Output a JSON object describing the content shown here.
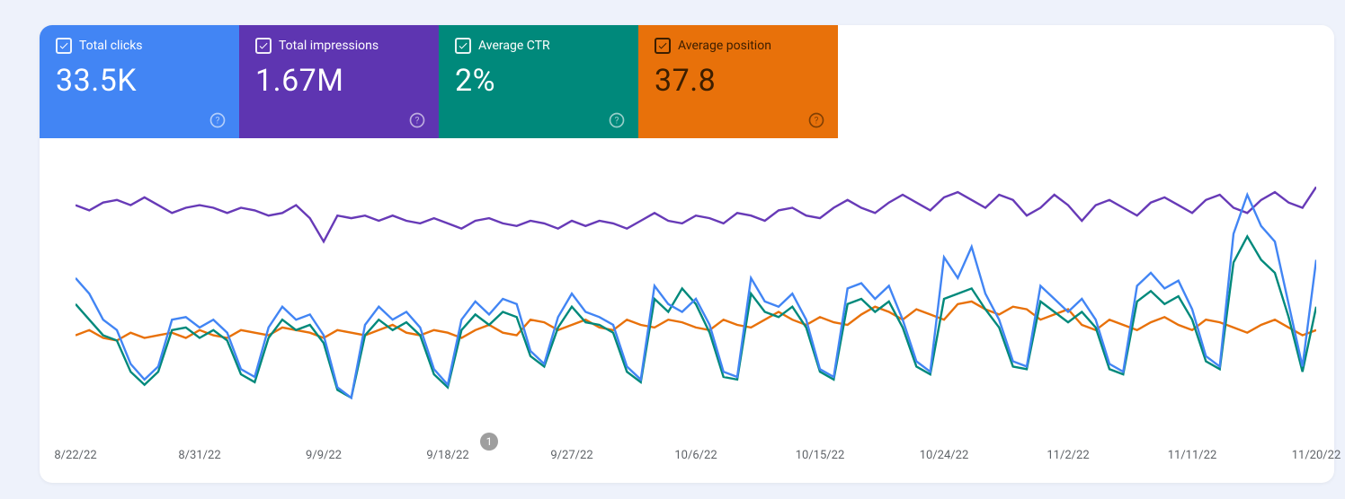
{
  "metrics": {
    "clicks": {
      "label": "Total clicks",
      "value": "33.5K"
    },
    "impressions": {
      "label": "Total impressions",
      "value": "1.67M"
    },
    "ctr": {
      "label": "Average CTR",
      "value": "2%"
    },
    "position": {
      "label": "Average position",
      "value": "37.8"
    }
  },
  "note_badge": "1",
  "x_ticks": [
    "8/22/22",
    "8/31/22",
    "9/9/22",
    "9/18/22",
    "9/27/22",
    "10/6/22",
    "10/15/22",
    "10/24/22",
    "11/2/22",
    "11/11/22",
    "11/20/22"
  ],
  "chart_data": {
    "type": "line",
    "title": "",
    "xlabel": "",
    "ylabel": "",
    "categories": [
      "8/22/22",
      "8/23/22",
      "8/24/22",
      "8/25/22",
      "8/26/22",
      "8/27/22",
      "8/28/22",
      "8/29/22",
      "8/30/22",
      "8/31/22",
      "9/1/22",
      "9/2/22",
      "9/3/22",
      "9/4/22",
      "9/5/22",
      "9/6/22",
      "9/7/22",
      "9/8/22",
      "9/9/22",
      "9/10/22",
      "9/11/22",
      "9/12/22",
      "9/13/22",
      "9/14/22",
      "9/15/22",
      "9/16/22",
      "9/17/22",
      "9/18/22",
      "9/19/22",
      "9/20/22",
      "9/21/22",
      "9/22/22",
      "9/23/22",
      "9/24/22",
      "9/25/22",
      "9/26/22",
      "9/27/22",
      "9/28/22",
      "9/29/22",
      "9/30/22",
      "10/1/22",
      "10/2/22",
      "10/3/22",
      "10/4/22",
      "10/5/22",
      "10/6/22",
      "10/7/22",
      "10/8/22",
      "10/9/22",
      "10/10/22",
      "10/11/22",
      "10/12/22",
      "10/13/22",
      "10/14/22",
      "10/15/22",
      "10/16/22",
      "10/17/22",
      "10/18/22",
      "10/19/22",
      "10/20/22",
      "10/21/22",
      "10/22/22",
      "10/23/22",
      "10/24/22",
      "10/25/22",
      "10/26/22",
      "10/27/22",
      "10/28/22",
      "10/29/22",
      "10/30/22",
      "10/31/22",
      "11/1/22",
      "11/2/22",
      "11/3/22",
      "11/4/22",
      "11/5/22",
      "11/6/22",
      "11/7/22",
      "11/8/22",
      "11/9/22",
      "11/10/22",
      "11/11/22",
      "11/12/22",
      "11/13/22",
      "11/14/22",
      "11/15/22",
      "11/16/22",
      "11/17/22",
      "11/18/22",
      "11/19/22",
      "11/20/22"
    ],
    "series": [
      {
        "name": "Impressions",
        "color": "#673ab7",
        "normalized": [
          0.86,
          0.84,
          0.87,
          0.88,
          0.86,
          0.89,
          0.86,
          0.83,
          0.85,
          0.86,
          0.85,
          0.83,
          0.85,
          0.84,
          0.82,
          0.83,
          0.86,
          0.81,
          0.72,
          0.82,
          0.81,
          0.82,
          0.8,
          0.82,
          0.8,
          0.79,
          0.81,
          0.79,
          0.77,
          0.8,
          0.81,
          0.79,
          0.78,
          0.8,
          0.79,
          0.77,
          0.8,
          0.78,
          0.8,
          0.79,
          0.77,
          0.8,
          0.83,
          0.8,
          0.79,
          0.82,
          0.81,
          0.79,
          0.83,
          0.82,
          0.8,
          0.84,
          0.85,
          0.82,
          0.81,
          0.85,
          0.88,
          0.85,
          0.83,
          0.87,
          0.9,
          0.87,
          0.84,
          0.89,
          0.91,
          0.88,
          0.85,
          0.9,
          0.88,
          0.82,
          0.85,
          0.9,
          0.86,
          0.8,
          0.86,
          0.88,
          0.85,
          0.82,
          0.87,
          0.89,
          0.86,
          0.83,
          0.88,
          0.9,
          0.85,
          0.83,
          0.88,
          0.91,
          0.87,
          0.85,
          0.93
        ]
      },
      {
        "name": "Clicks",
        "color": "#4285f4",
        "normalized": [
          0.58,
          0.52,
          0.42,
          0.38,
          0.25,
          0.19,
          0.24,
          0.42,
          0.43,
          0.39,
          0.42,
          0.37,
          0.23,
          0.2,
          0.39,
          0.47,
          0.42,
          0.44,
          0.36,
          0.16,
          0.12,
          0.4,
          0.47,
          0.42,
          0.45,
          0.39,
          0.23,
          0.17,
          0.42,
          0.49,
          0.44,
          0.5,
          0.48,
          0.3,
          0.25,
          0.43,
          0.52,
          0.45,
          0.43,
          0.4,
          0.24,
          0.19,
          0.55,
          0.48,
          0.45,
          0.5,
          0.4,
          0.22,
          0.2,
          0.58,
          0.49,
          0.47,
          0.52,
          0.42,
          0.23,
          0.2,
          0.54,
          0.56,
          0.5,
          0.55,
          0.42,
          0.26,
          0.22,
          0.66,
          0.58,
          0.7,
          0.52,
          0.42,
          0.26,
          0.24,
          0.55,
          0.5,
          0.45,
          0.5,
          0.42,
          0.25,
          0.22,
          0.55,
          0.6,
          0.54,
          0.57,
          0.46,
          0.28,
          0.24,
          0.75,
          0.9,
          0.78,
          0.72,
          0.48,
          0.24,
          0.65
        ]
      },
      {
        "name": "CTR",
        "color": "#00897b",
        "normalized": [
          0.48,
          0.42,
          0.36,
          0.34,
          0.22,
          0.17,
          0.22,
          0.38,
          0.39,
          0.35,
          0.38,
          0.34,
          0.21,
          0.18,
          0.35,
          0.42,
          0.38,
          0.4,
          0.33,
          0.15,
          0.12,
          0.36,
          0.42,
          0.38,
          0.41,
          0.36,
          0.21,
          0.16,
          0.38,
          0.44,
          0.4,
          0.45,
          0.43,
          0.28,
          0.24,
          0.39,
          0.47,
          0.41,
          0.4,
          0.37,
          0.22,
          0.18,
          0.5,
          0.45,
          0.54,
          0.48,
          0.37,
          0.2,
          0.19,
          0.52,
          0.45,
          0.43,
          0.47,
          0.39,
          0.22,
          0.19,
          0.48,
          0.5,
          0.45,
          0.49,
          0.39,
          0.24,
          0.21,
          0.5,
          0.52,
          0.54,
          0.46,
          0.39,
          0.24,
          0.23,
          0.49,
          0.45,
          0.41,
          0.45,
          0.39,
          0.23,
          0.21,
          0.49,
          0.53,
          0.48,
          0.51,
          0.42,
          0.26,
          0.23,
          0.64,
          0.74,
          0.65,
          0.6,
          0.43,
          0.22,
          0.47
        ]
      },
      {
        "name": "Position",
        "color": "#e8710a",
        "normalized": [
          0.36,
          0.38,
          0.35,
          0.34,
          0.37,
          0.35,
          0.36,
          0.37,
          0.35,
          0.38,
          0.36,
          0.35,
          0.38,
          0.37,
          0.36,
          0.39,
          0.38,
          0.37,
          0.35,
          0.38,
          0.37,
          0.36,
          0.38,
          0.4,
          0.37,
          0.36,
          0.38,
          0.37,
          0.35,
          0.38,
          0.4,
          0.37,
          0.36,
          0.42,
          0.41,
          0.38,
          0.4,
          0.42,
          0.39,
          0.38,
          0.42,
          0.4,
          0.39,
          0.42,
          0.41,
          0.39,
          0.38,
          0.42,
          0.4,
          0.39,
          0.42,
          0.45,
          0.42,
          0.4,
          0.43,
          0.41,
          0.4,
          0.44,
          0.47,
          0.45,
          0.42,
          0.46,
          0.44,
          0.42,
          0.48,
          0.49,
          0.46,
          0.44,
          0.47,
          0.46,
          0.42,
          0.44,
          0.46,
          0.4,
          0.38,
          0.42,
          0.4,
          0.38,
          0.41,
          0.43,
          0.4,
          0.38,
          0.42,
          0.41,
          0.39,
          0.37,
          0.4,
          0.42,
          0.39,
          0.36,
          0.38
        ]
      }
    ]
  }
}
